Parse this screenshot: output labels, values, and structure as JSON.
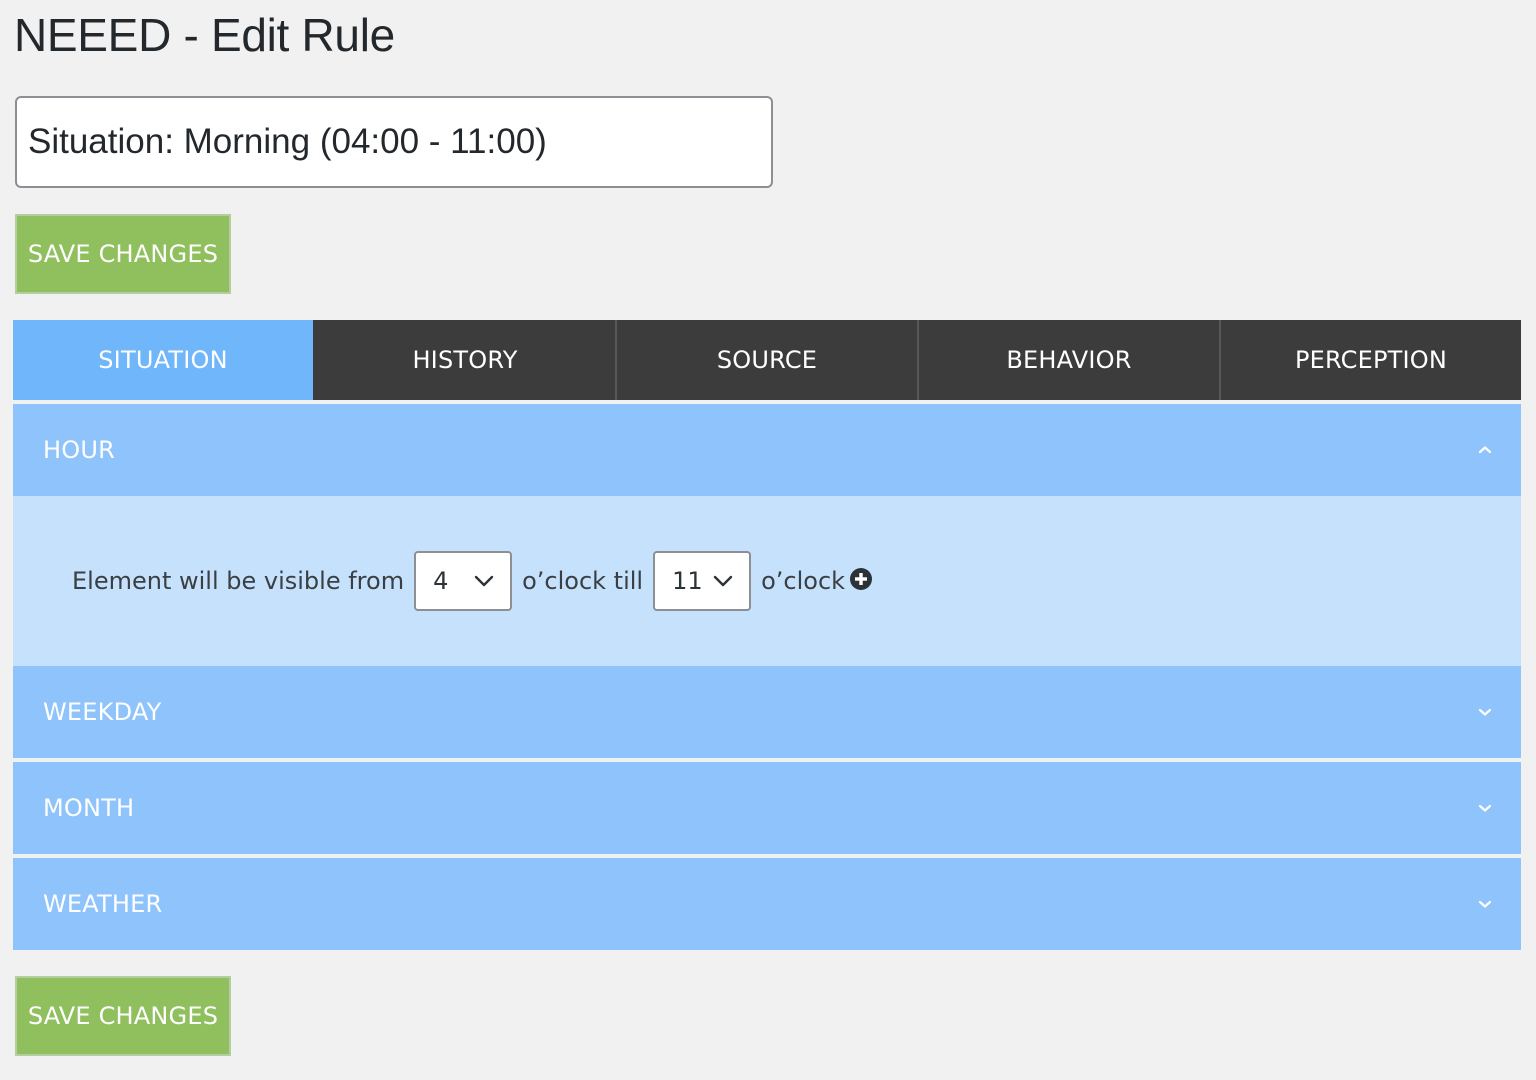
{
  "page": {
    "title": "NEEED - Edit Rule"
  },
  "rule": {
    "name_value": "Situation: Morning (04:00 - 11:00)"
  },
  "buttons": {
    "save_top": "SAVE CHANGES",
    "save_bottom": "SAVE CHANGES"
  },
  "tabs": [
    {
      "label": "SITUATION",
      "active": true
    },
    {
      "label": "HISTORY",
      "active": false
    },
    {
      "label": "SOURCE",
      "active": false
    },
    {
      "label": "BEHAVIOR",
      "active": false
    },
    {
      "label": "PERCEPTION",
      "active": false
    }
  ],
  "sections": [
    {
      "label": "HOUR",
      "expanded": true,
      "icon": "chevron-up-icon"
    },
    {
      "label": "WEEKDAY",
      "expanded": false,
      "icon": "chevron-down-icon"
    },
    {
      "label": "MONTH",
      "expanded": false,
      "icon": "chevron-down-icon"
    },
    {
      "label": "WEATHER",
      "expanded": false,
      "icon": "chevron-down-icon"
    }
  ],
  "hour": {
    "prefix": "Element will be visible from",
    "from_value": "4",
    "middle": "o’clock till",
    "till_value": "11",
    "suffix": "o’clock",
    "add_icon": "plus-circle-icon"
  },
  "colors": {
    "accent_green": "#8fc05d",
    "tab_active": "#6fb6fa",
    "tab_bar": "#3c3c3c",
    "section_header": "#8ec3fb",
    "section_body": "#c6e1fc",
    "background": "#f1f1f1"
  }
}
